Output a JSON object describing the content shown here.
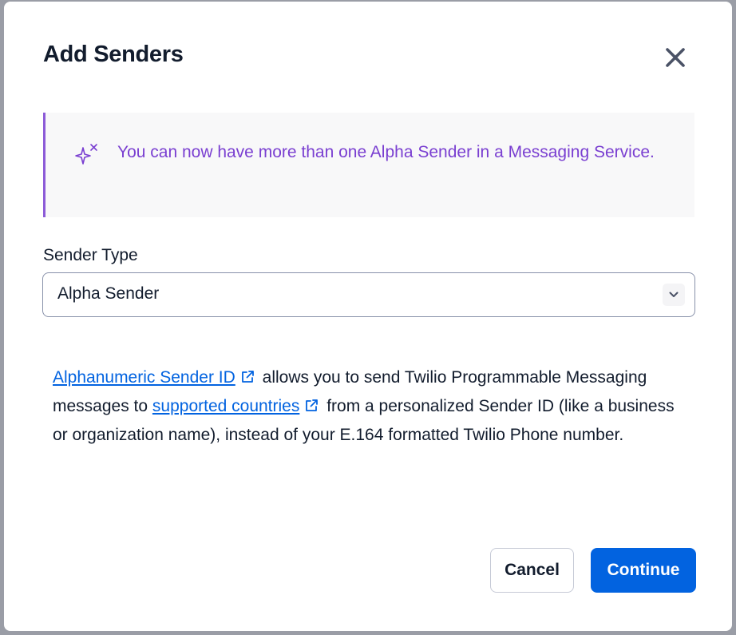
{
  "modal": {
    "title": "Add Senders",
    "close_label": "Close"
  },
  "callout": {
    "icon": "sparkle-icon",
    "text": "You can now have more than one Alpha Sender in a Messaging Service."
  },
  "sender_type": {
    "label": "Sender Type",
    "selected": "Alpha Sender"
  },
  "description": {
    "link1": "Alphanumeric Sender ID",
    "text1": "allows you to send Twilio Programmable Messaging messages to",
    "link2": "supported countries",
    "text2": "from a personalized Sender ID (like a business or organization name), instead of your E.164 formatted Twilio Phone number."
  },
  "footer": {
    "cancel_label": "Cancel",
    "continue_label": "Continue"
  },
  "colors": {
    "primary": "#0263e0",
    "callout_accent": "#8c5bd8",
    "callout_text": "#7a3fd1",
    "text": "#121c2d"
  }
}
